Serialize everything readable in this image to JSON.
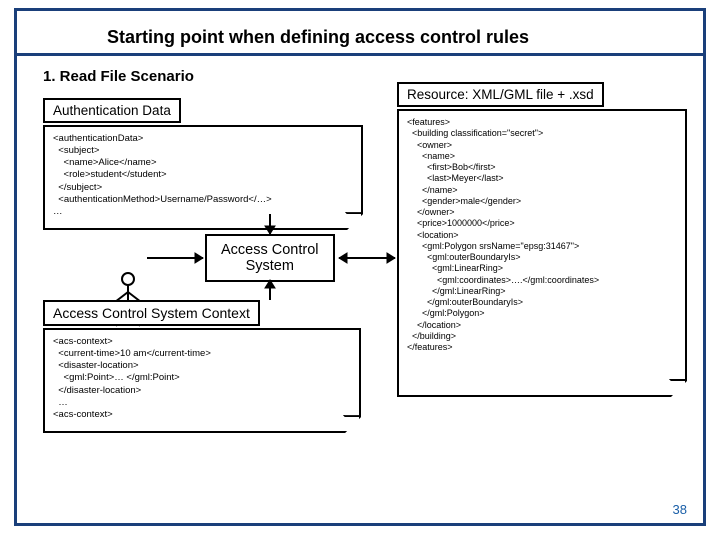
{
  "page_number": "38",
  "title": "Starting point when defining access control rules",
  "heading1": "1.  Read File Scenario",
  "labels": {
    "auth_data": "Authentication Data",
    "resource": "Resource: XML/GML file + .xsd",
    "acs": "Access Control\nSystem",
    "acs_context": "Access Control System Context"
  },
  "auth_xml": "<authenticationData>\n  <subject>\n    <name>Alice</name>\n    <role>student</student>\n  </subject>\n  <authenticationMethod>Username/Password</…>\n…",
  "context_xml": "<acs-context>\n  <current-time>10 am</current-time>\n  <disaster-location>\n    <gml:Point>… </gml:Point>\n  </disaster-location>\n  …\n<acs-context>",
  "resource_xml": "<features>\n  <building classification=\"secret\">\n    <owner>\n      <name>\n        <first>Bob</first>\n        <last>Meyer</last>\n      </name>\n      <gender>male</gender>\n    </owner>\n    <price>1000000</price>\n    <location>\n      <gml:Polygon srsName=\"epsg:31467\">\n        <gml:outerBoundaryIs>\n          <gml:LinearRing>\n            <gml:coordinates>….</gml:coordinates>\n          </gml:LinearRing>\n        </gml:outerBoundaryIs>\n      </gml:Polygon>\n    </location>\n  </building>\n</features>"
}
